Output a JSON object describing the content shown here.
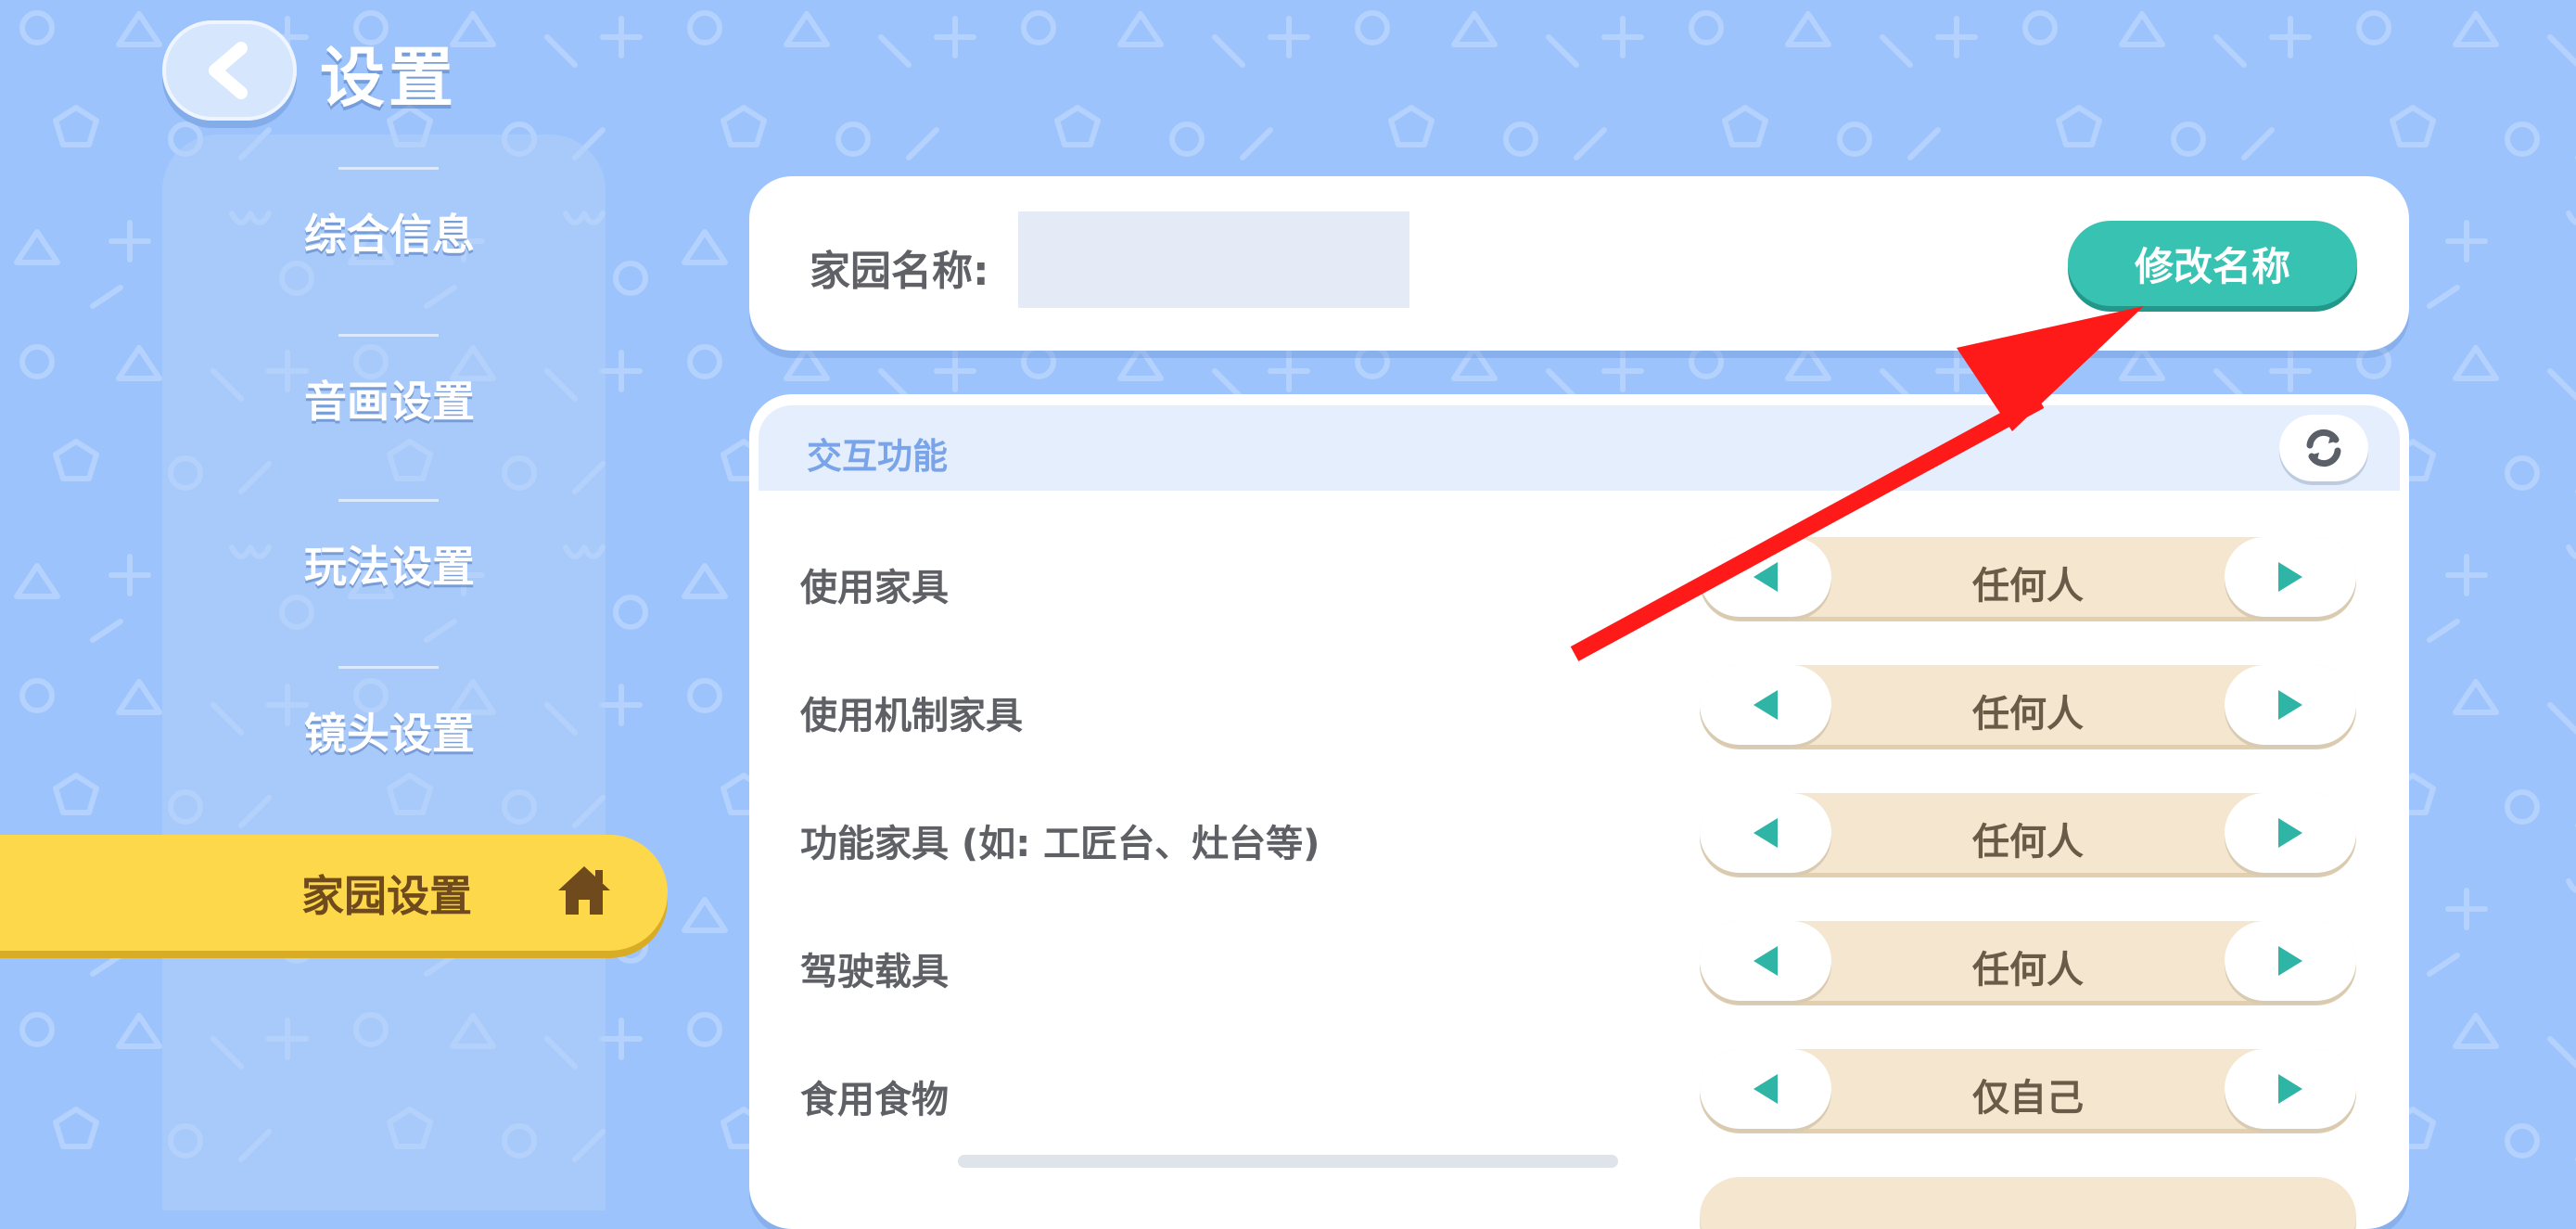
{
  "header": {
    "back_icon": "chevron-left-icon",
    "title": "设置"
  },
  "sidebar": {
    "items": [
      {
        "label": "综合信息",
        "active": false
      },
      {
        "label": "音画设置",
        "active": false
      },
      {
        "label": "玩法设置",
        "active": false
      },
      {
        "label": "镜头设置",
        "active": false
      },
      {
        "label": "家园设置",
        "active": true,
        "icon": "home-icon"
      }
    ]
  },
  "home_name": {
    "label": "家园名称:",
    "rename_button": "修改名称"
  },
  "interaction": {
    "section_title": "交互功能",
    "refresh_icon": "refresh-icon",
    "rows": [
      {
        "label": "使用家具",
        "value": "任何人"
      },
      {
        "label": "使用机制家具",
        "value": "任何人"
      },
      {
        "label": "功能家具 (如: 工匠台、灶台等)",
        "value": "任何人"
      },
      {
        "label": "驾驶载具",
        "value": "任何人"
      },
      {
        "label": "食用食物",
        "value": "仅自己"
      }
    ]
  },
  "colors": {
    "background": "#9cc3fb",
    "accent_teal": "#38c2b2",
    "active_tab": "#fdd84a",
    "selector_bg": "#f5e6cf",
    "annotation_arrow": "#ff1a1a"
  }
}
